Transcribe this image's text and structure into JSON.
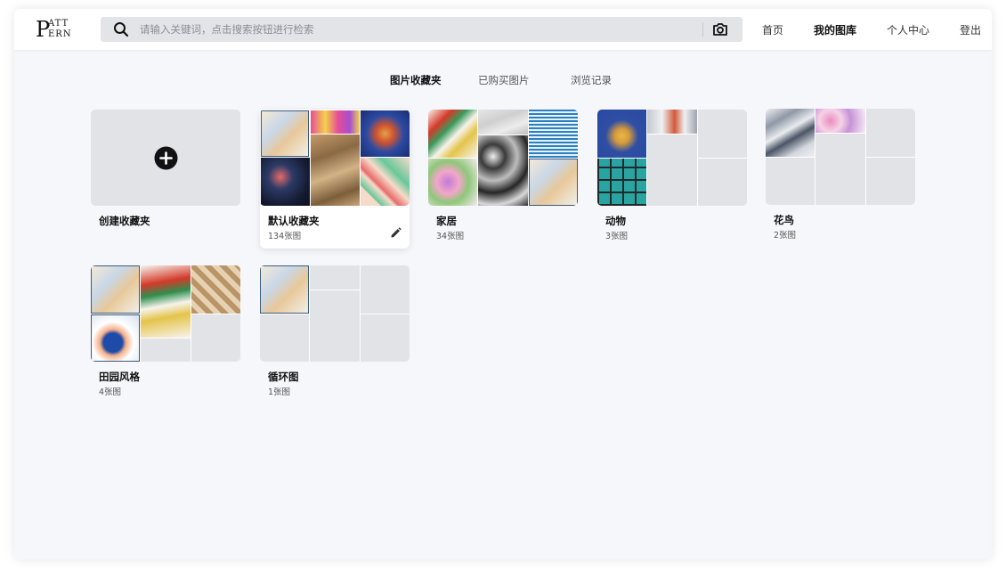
{
  "header": {
    "logo": {
      "big": "P",
      "line1": "ATT",
      "line2": "ERN"
    },
    "search": {
      "placeholder": "请输入关键词，点击搜索按钮进行检索",
      "value": ""
    },
    "nav": [
      {
        "label": "首页",
        "active": false
      },
      {
        "label": "我的图库",
        "active": true
      },
      {
        "label": "个人中心",
        "active": false
      },
      {
        "label": "登出",
        "active": false
      }
    ]
  },
  "tabs": [
    {
      "label": "图片收藏夹",
      "active": true
    },
    {
      "label": "已购买图片",
      "active": false
    },
    {
      "label": "浏览记录",
      "active": false
    }
  ],
  "create": {
    "label": "创建收藏夹"
  },
  "folders": [
    {
      "title": "默认收藏夹",
      "count": "134张图",
      "editable": true
    },
    {
      "title": "家居",
      "count": "34张图"
    },
    {
      "title": "动物",
      "count": "3张图"
    },
    {
      "title": "花鸟",
      "count": "2张图"
    },
    {
      "title": "田园风格",
      "count": "4张图"
    },
    {
      "title": "循环图",
      "count": "1张图"
    }
  ],
  "colors": {
    "background": "#f6f7fb",
    "header": "#ffffff",
    "placeholder_tile": "#e2e3e7",
    "search_bg": "#e3e4e8"
  },
  "icons": [
    "search-icon",
    "camera-icon",
    "plus-circle-icon",
    "pencil-icon"
  ]
}
